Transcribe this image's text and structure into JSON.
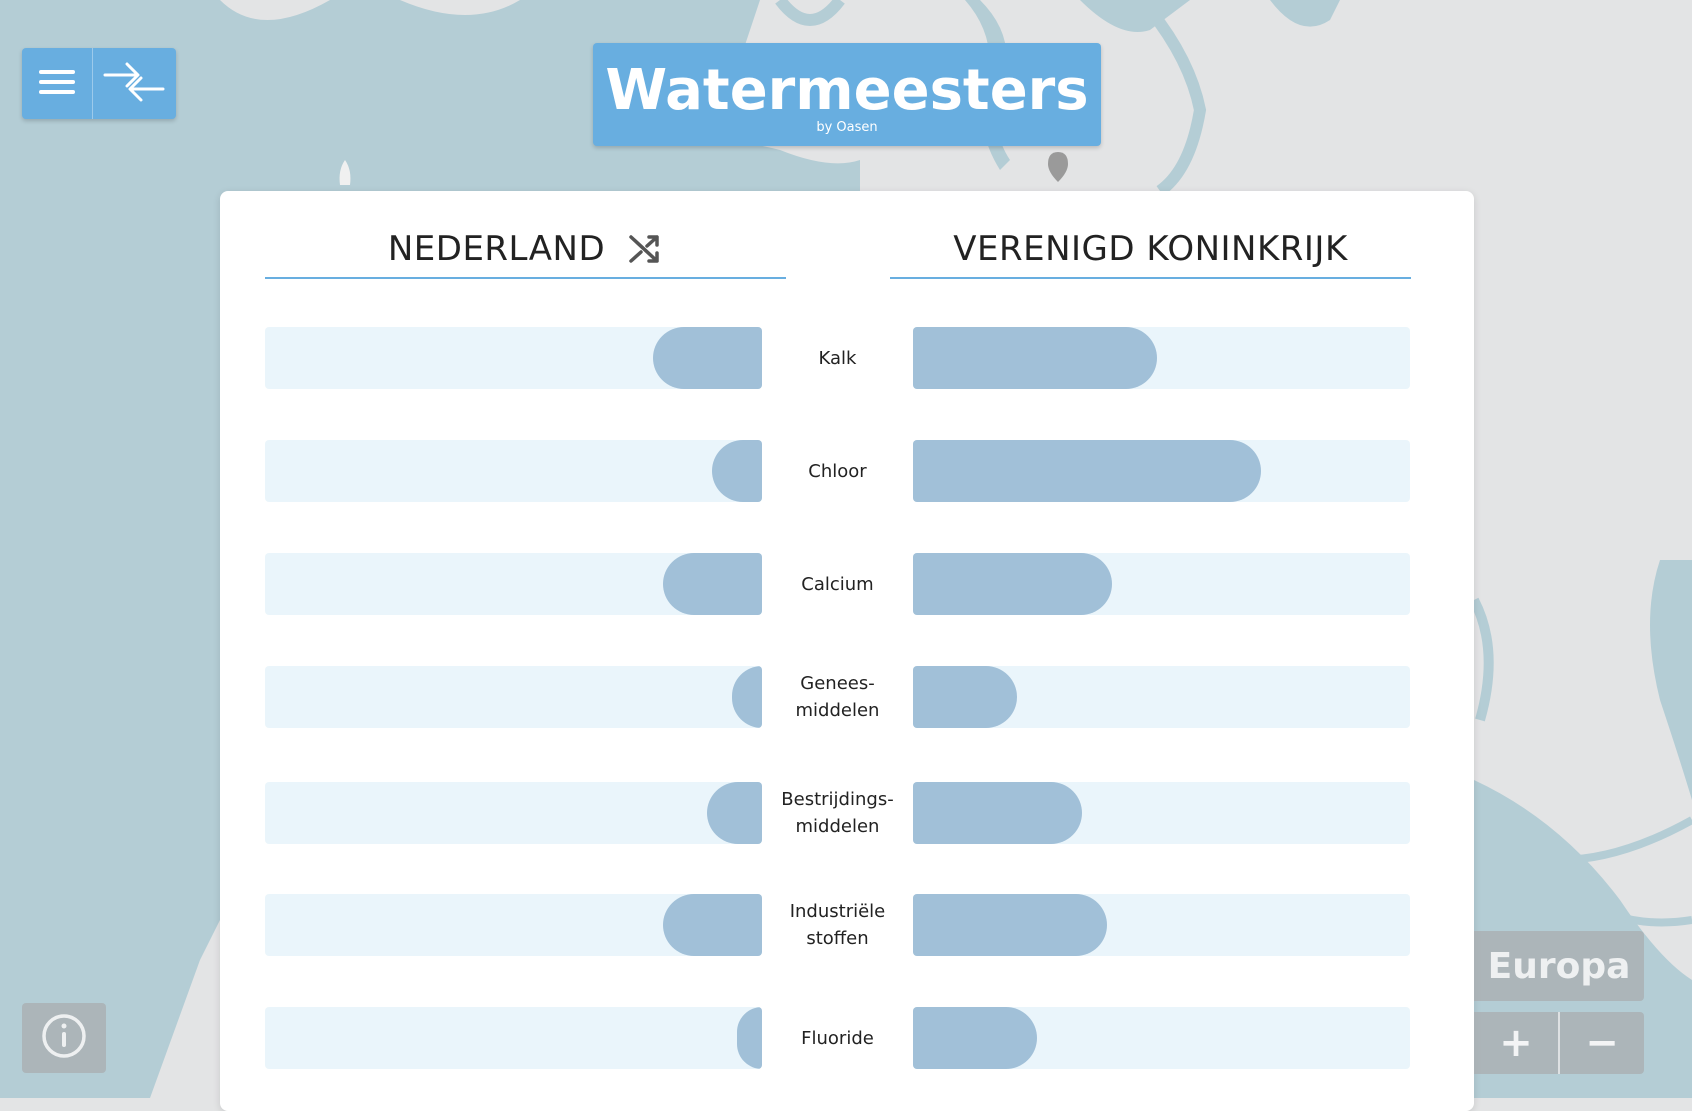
{
  "app": {
    "title": "Watermeesters",
    "subtitle": "by Oasen"
  },
  "toolbar": {
    "menu_icon": "hamburger-menu-icon",
    "compare_icon": "compare-arrows-icon"
  },
  "comparison": {
    "left_country": "NEDERLAND",
    "right_country": "VERENIGD KONINKRIJK",
    "shuffle_icon": "shuffle-icon",
    "rows": [
      {
        "label": "Kalk",
        "left_level": 0.22,
        "right_level": 0.49
      },
      {
        "label": "Chloor",
        "left_level": 0.1,
        "right_level": 0.7
      },
      {
        "label": "Calcium",
        "left_level": 0.2,
        "right_level": 0.4
      },
      {
        "label": "Genees-\nmiddelen",
        "left_level": 0.06,
        "right_level": 0.21
      },
      {
        "label": "Bestrijdings-\nmiddelen",
        "left_level": 0.11,
        "right_level": 0.34
      },
      {
        "label": "Industriële\nstoffen",
        "left_level": 0.2,
        "right_level": 0.39
      },
      {
        "label": "Fluoride",
        "left_level": 0.05,
        "right_level": 0.25
      }
    ]
  },
  "map_controls": {
    "region_label": "Europa",
    "zoom_in": "+",
    "zoom_out": "−",
    "info_icon": "info-icon"
  },
  "colors": {
    "accent": "#68aee0",
    "bar_fill": "#a1c0d8",
    "bar_track": "#eaf5fb",
    "water": "#b4cdd5",
    "land": "#e3e4e5"
  }
}
